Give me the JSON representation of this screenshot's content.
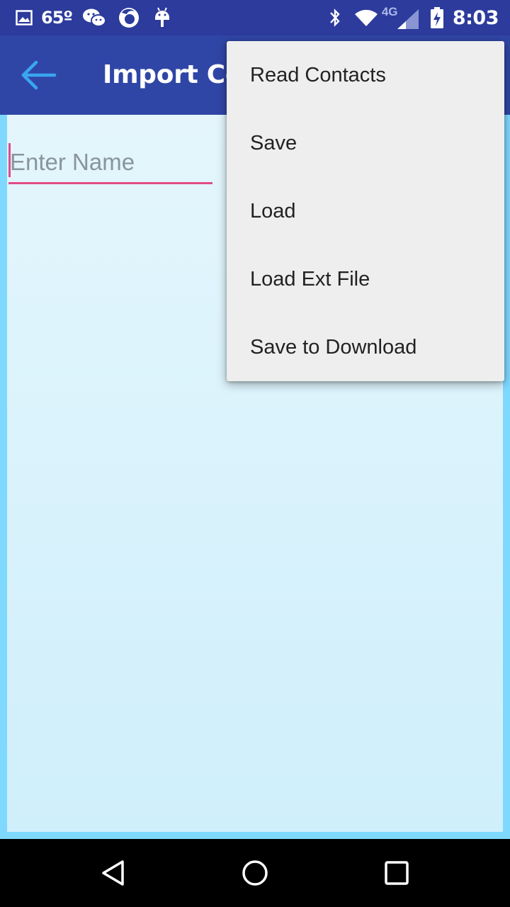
{
  "status_bar": {
    "temperature": "65º",
    "time": "8:03",
    "network_type": "4G",
    "left_icons": [
      "image-icon",
      "wechat-icon",
      "firefox-icon",
      "android-icon"
    ],
    "right_icons": [
      "bluetooth-icon",
      "wifi-icon",
      "lte-signal-icon",
      "battery-charging-icon"
    ]
  },
  "app_bar": {
    "title": "Import Co",
    "back_icon": "arrow-left-icon"
  },
  "form": {
    "name_value": "",
    "name_placeholder": "Enter Name"
  },
  "menu": {
    "items": [
      {
        "label": "Read Contacts"
      },
      {
        "label": "Save"
      },
      {
        "label": "Load"
      },
      {
        "label": "Load Ext File"
      },
      {
        "label": "Save to Download"
      }
    ]
  },
  "nav_bar": {
    "buttons": [
      "back-triangle-icon",
      "home-circle-icon",
      "recents-square-icon"
    ]
  },
  "colors": {
    "status_bar": "#2c3b9c",
    "app_bar": "#3046a6",
    "accent": "#e24a85",
    "back_arrow": "#3aa6f0",
    "content_top": "#e4f6fc",
    "content_bottom": "#cfeffb",
    "frame": "#7fd9ff",
    "menu_bg": "#eeeeee"
  }
}
